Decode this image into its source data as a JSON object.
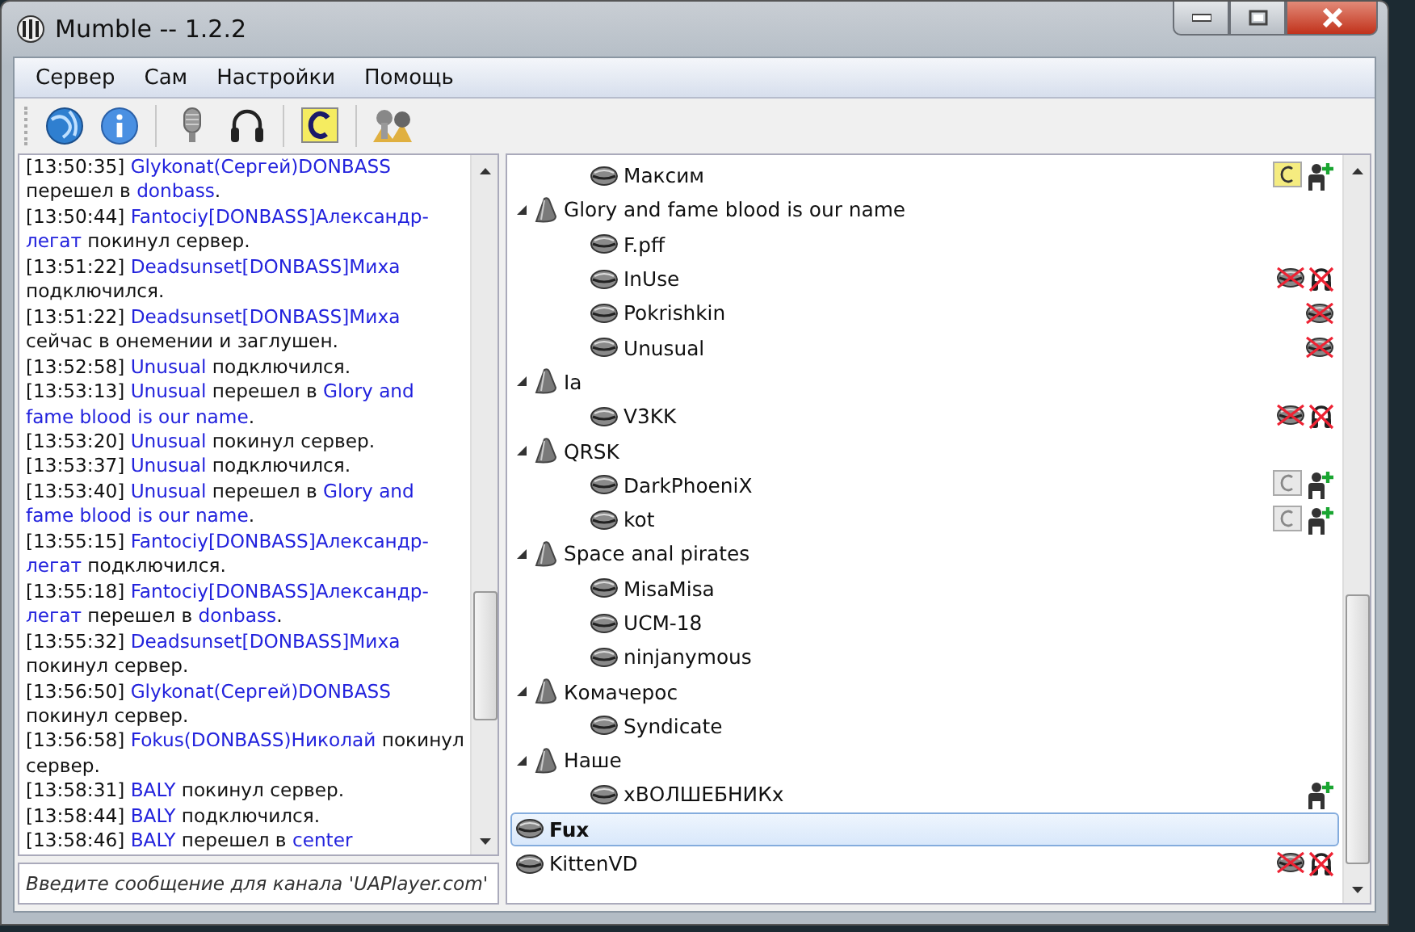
{
  "window": {
    "title": "Mumble -- 1.2.2"
  },
  "menu": [
    "Сервер",
    "Сам",
    "Настройки",
    "Помощь"
  ],
  "toolbar": [
    {
      "kind": "globe"
    },
    {
      "kind": "info"
    },
    {
      "kind": "sep"
    },
    {
      "kind": "mic"
    },
    {
      "kind": "headphones"
    },
    {
      "kind": "sep"
    },
    {
      "kind": "comment"
    },
    {
      "kind": "sep"
    },
    {
      "kind": "wizard"
    }
  ],
  "log": [
    {
      "time": "[13:50:35]",
      "parts": [
        {
          "kind": "link",
          "text": "Glykonat(Сергей)DONBASS"
        },
        {
          "kind": "text",
          "text": " перешел в "
        },
        {
          "kind": "link",
          "text": "donbass"
        },
        {
          "kind": "text",
          "text": "."
        }
      ]
    },
    {
      "time": "[13:50:44]",
      "parts": [
        {
          "kind": "link",
          "text": "Fantociy[DONBASS]Александр-легат"
        },
        {
          "kind": "text",
          "text": " покинул сервер."
        }
      ]
    },
    {
      "time": "[13:51:22]",
      "parts": [
        {
          "kind": "link",
          "text": "Deadsunset[DONBASS]Миха"
        },
        {
          "kind": "text",
          "text": " подключился."
        }
      ]
    },
    {
      "time": "[13:51:22]",
      "parts": [
        {
          "kind": "link",
          "text": "Deadsunset[DONBASS]Миха"
        },
        {
          "kind": "text",
          "text": " сейчас в онемении и заглушен."
        }
      ]
    },
    {
      "time": "[13:52:58]",
      "parts": [
        {
          "kind": "link",
          "text": "Unusual"
        },
        {
          "kind": "text",
          "text": " подключился."
        }
      ]
    },
    {
      "time": "[13:53:13]",
      "parts": [
        {
          "kind": "link",
          "text": "Unusual"
        },
        {
          "kind": "text",
          "text": " перешел в "
        },
        {
          "kind": "link",
          "text": "Glory and fame blood is our name"
        },
        {
          "kind": "text",
          "text": "."
        }
      ]
    },
    {
      "time": "[13:53:20]",
      "parts": [
        {
          "kind": "link",
          "text": "Unusual"
        },
        {
          "kind": "text",
          "text": " покинул сервер."
        }
      ]
    },
    {
      "time": "[13:53:37]",
      "parts": [
        {
          "kind": "link",
          "text": "Unusual"
        },
        {
          "kind": "text",
          "text": " подключился."
        }
      ]
    },
    {
      "time": "[13:53:40]",
      "parts": [
        {
          "kind": "link",
          "text": "Unusual"
        },
        {
          "kind": "text",
          "text": " перешел в "
        },
        {
          "kind": "link",
          "text": "Glory and fame blood is our name"
        },
        {
          "kind": "text",
          "text": "."
        }
      ]
    },
    {
      "time": "[13:55:15]",
      "parts": [
        {
          "kind": "link",
          "text": "Fantociy[DONBASS]Александр-легат"
        },
        {
          "kind": "text",
          "text": " подключился."
        }
      ]
    },
    {
      "time": "[13:55:18]",
      "parts": [
        {
          "kind": "link",
          "text": "Fantociy[DONBASS]Александр-легат"
        },
        {
          "kind": "text",
          "text": " перешел в "
        },
        {
          "kind": "link",
          "text": "donbass"
        },
        {
          "kind": "text",
          "text": "."
        }
      ]
    },
    {
      "time": "[13:55:32]",
      "parts": [
        {
          "kind": "link",
          "text": "Deadsunset[DONBASS]Миха"
        },
        {
          "kind": "text",
          "text": " покинул сервер."
        }
      ]
    },
    {
      "time": "[13:56:50]",
      "parts": [
        {
          "kind": "link",
          "text": "Glykonat(Сергей)DONBASS"
        },
        {
          "kind": "text",
          "text": " покинул сервер."
        }
      ]
    },
    {
      "time": "[13:56:58]",
      "parts": [
        {
          "kind": "link",
          "text": "Fokus(DONBASS)Николай"
        },
        {
          "kind": "text",
          "text": " покинул сервер."
        }
      ]
    },
    {
      "time": "[13:58:31]",
      "parts": [
        {
          "kind": "link",
          "text": "BALY"
        },
        {
          "kind": "text",
          "text": " покинул сервер."
        }
      ]
    },
    {
      "time": "[13:58:44]",
      "parts": [
        {
          "kind": "link",
          "text": "BALY"
        },
        {
          "kind": "text",
          "text": " подключился."
        }
      ]
    },
    {
      "time": "[13:58:46]",
      "parts": [
        {
          "kind": "link",
          "text": "BALY"
        },
        {
          "kind": "text",
          "text": " перешел в "
        },
        {
          "kind": "link",
          "text": "center"
        }
      ]
    }
  ],
  "message_field": {
    "placeholder": "Введите сообщение для канала 'UAPlayer.com'"
  },
  "tree": [
    {
      "kind": "offscreen",
      "children": [
        {
          "kind": "offscreen",
          "children": [
            {
              "kind": "user",
              "name": "Максим",
              "selected": false,
              "self": false,
              "comment": true,
              "comment_read": false,
              "registered": true,
              "muted": false,
              "deafened": false
            }
          ]
        },
        {
          "kind": "channel",
          "name": "Glory and fame blood is our name",
          "expanded": true,
          "children": [
            {
              "kind": "user",
              "name": "F.pff",
              "selected": false,
              "self": false,
              "comment": false,
              "registered": false,
              "muted": false,
              "deafened": false
            },
            {
              "kind": "user",
              "name": "InUse",
              "selected": false,
              "self": false,
              "comment": false,
              "registered": false,
              "muted": true,
              "deafened": true
            },
            {
              "kind": "user",
              "name": "Pokrishkin",
              "selected": false,
              "self": false,
              "comment": false,
              "registered": false,
              "muted": true,
              "deafened": false
            },
            {
              "kind": "user",
              "name": "Unusual",
              "selected": false,
              "self": false,
              "comment": false,
              "registered": false,
              "muted": true,
              "deafened": false
            }
          ]
        },
        {
          "kind": "channel",
          "name": "Ia",
          "expanded": true,
          "children": [
            {
              "kind": "user",
              "name": "V3KK",
              "selected": false,
              "self": false,
              "comment": false,
              "registered": false,
              "muted": true,
              "deafened": true
            }
          ]
        },
        {
          "kind": "channel",
          "name": "QRSK",
          "expanded": true,
          "children": [
            {
              "kind": "user",
              "name": "DarkPhoeniX",
              "selected": false,
              "self": false,
              "comment": true,
              "comment_read": true,
              "registered": true,
              "muted": false,
              "deafened": false
            },
            {
              "kind": "user",
              "name": "kot",
              "selected": false,
              "self": false,
              "comment": true,
              "comment_read": true,
              "registered": true,
              "muted": false,
              "deafened": false
            }
          ]
        },
        {
          "kind": "channel",
          "name": "Space anal pirates",
          "expanded": true,
          "children": [
            {
              "kind": "user",
              "name": "MisaMisa",
              "selected": false,
              "self": false,
              "comment": false,
              "registered": false,
              "muted": false,
              "deafened": false
            },
            {
              "kind": "user",
              "name": "UCM-18",
              "selected": false,
              "self": false,
              "comment": false,
              "registered": false,
              "muted": false,
              "deafened": false
            },
            {
              "kind": "user",
              "name": "ninjanymous",
              "selected": false,
              "self": false,
              "comment": false,
              "registered": false,
              "muted": false,
              "deafened": false
            }
          ]
        },
        {
          "kind": "channel",
          "name": "Комачерос",
          "expanded": true,
          "children": [
            {
              "kind": "user",
              "name": "Syndicate",
              "selected": false,
              "self": false,
              "comment": false,
              "registered": false,
              "muted": false,
              "deafened": false
            }
          ]
        },
        {
          "kind": "channel",
          "name": "Наше",
          "expanded": true,
          "children": [
            {
              "kind": "user",
              "name": "xВОЛШЕБНИКx",
              "selected": false,
              "self": false,
              "comment": false,
              "registered": true,
              "muted": false,
              "deafened": false
            }
          ]
        }
      ]
    },
    {
      "kind": "user",
      "name": "Fux",
      "selected": true,
      "self": true,
      "comment": false,
      "registered": false,
      "muted": false,
      "deafened": false
    },
    {
      "kind": "user",
      "name": "KittenVD",
      "selected": false,
      "self": false,
      "comment": false,
      "registered": false,
      "muted": true,
      "deafened": true
    }
  ]
}
